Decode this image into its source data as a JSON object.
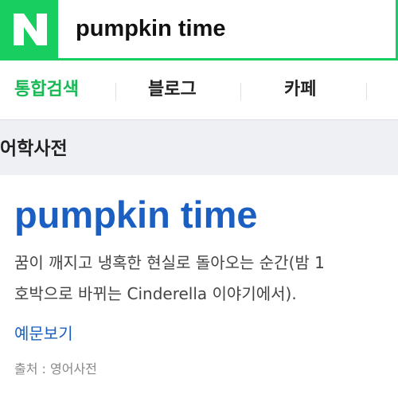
{
  "header": {
    "logo_letter": "N",
    "search_query": "pumpkin time",
    "brand_color": "#19ce60",
    "logo_icon": "naver-logo-icon"
  },
  "tabs": [
    {
      "label": "통합검색",
      "active": true
    },
    {
      "label": "블로그",
      "active": false
    },
    {
      "label": "카페",
      "active": false
    }
  ],
  "section": {
    "title": "어학사전"
  },
  "entry": {
    "title": "pumpkin time",
    "definition_line1": "꿈이 깨지고 냉혹한 현실로 돌아오는 순간(밤 1",
    "definition_line2": "호박으로 바뀌는 Cinderella 이야기에서).",
    "examples_link": "예문보기",
    "source": "출처 : 영어사전",
    "title_color": "#1a5fc1"
  }
}
